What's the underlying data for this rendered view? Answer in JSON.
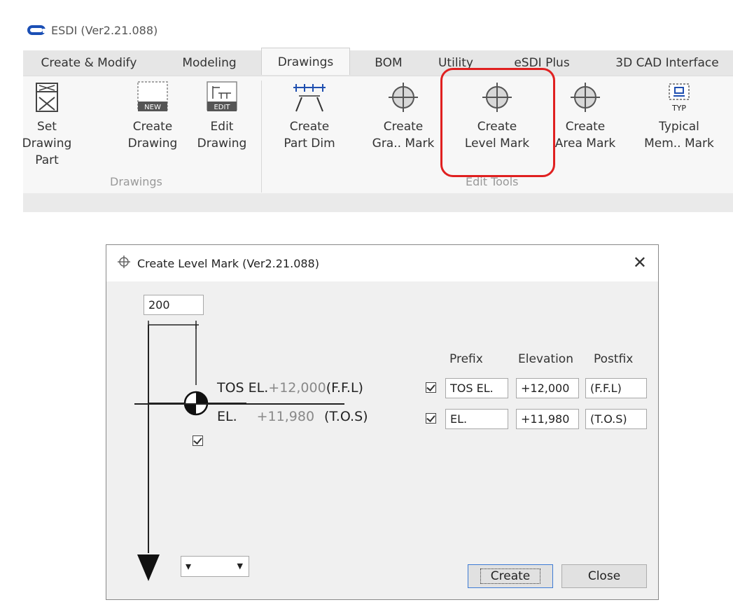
{
  "app": {
    "title": "ESDI (Ver2.21.088)"
  },
  "tabs": [
    {
      "label": "Create & Modify"
    },
    {
      "label": "Modeling"
    },
    {
      "label": "Drawings"
    },
    {
      "label": "BOM"
    },
    {
      "label": "Utility"
    },
    {
      "label": "eSDI Plus"
    },
    {
      "label": "3D CAD Interface"
    }
  ],
  "active_tab": "Drawings",
  "ribbon": {
    "buttons": [
      {
        "line1": "Set Drawing",
        "line2": "Part",
        "icon": "set-drawing-part-icon"
      },
      {
        "line1": "Create",
        "line2": "Drawing",
        "icon": "new-drawing-icon",
        "badge": "NEW"
      },
      {
        "line1": "Edit",
        "line2": "Drawing",
        "icon": "edit-drawing-icon",
        "badge": "EDIT"
      },
      {
        "line1": "Create",
        "line2": "Part Dim",
        "icon": "part-dim-icon"
      },
      {
        "line1": "Create",
        "line2": "Gra.. Mark",
        "icon": "crosshair-icon"
      },
      {
        "line1": "Create",
        "line2": "Level Mark",
        "icon": "crosshair-icon"
      },
      {
        "line1": "Create",
        "line2": "Area Mark",
        "icon": "crosshair-icon"
      },
      {
        "line1": "Typical",
        "line2": "Mem.. Mark",
        "icon": "typical-member-icon",
        "badge": "TYP"
      }
    ],
    "groups": [
      {
        "label": "Drawings"
      },
      {
        "label": "Edit Tools"
      }
    ]
  },
  "dialog": {
    "title": "Create Level Mark  (Ver2.21.088)",
    "length_value": "200",
    "preview_line1_prefix": "TOS EL.",
    "preview_line1_value": "+12,000",
    "preview_line1_postfix": "(F.F.L)",
    "preview_line2_prefix": "EL.",
    "preview_line2_value": "+11,980",
    "preview_line2_postfix": "(T.O.S)",
    "headers": {
      "prefix": "Prefix",
      "elevation": "Elevation",
      "postfix": "Postfix"
    },
    "rows": [
      {
        "checked": true,
        "prefix": "TOS EL.",
        "elevation": "+12,000",
        "postfix": "(F.F.L)"
      },
      {
        "checked": true,
        "prefix": "EL.",
        "elevation": "+11,980",
        "postfix": "(T.O.S)"
      }
    ],
    "symbol_checked": true,
    "arrow_select": "▾",
    "create_label": "Create",
    "close_label": "Close",
    "close_glyph": "✕"
  },
  "colors": {
    "highlight": "#e02020",
    "logo": "#1b4fb5"
  }
}
